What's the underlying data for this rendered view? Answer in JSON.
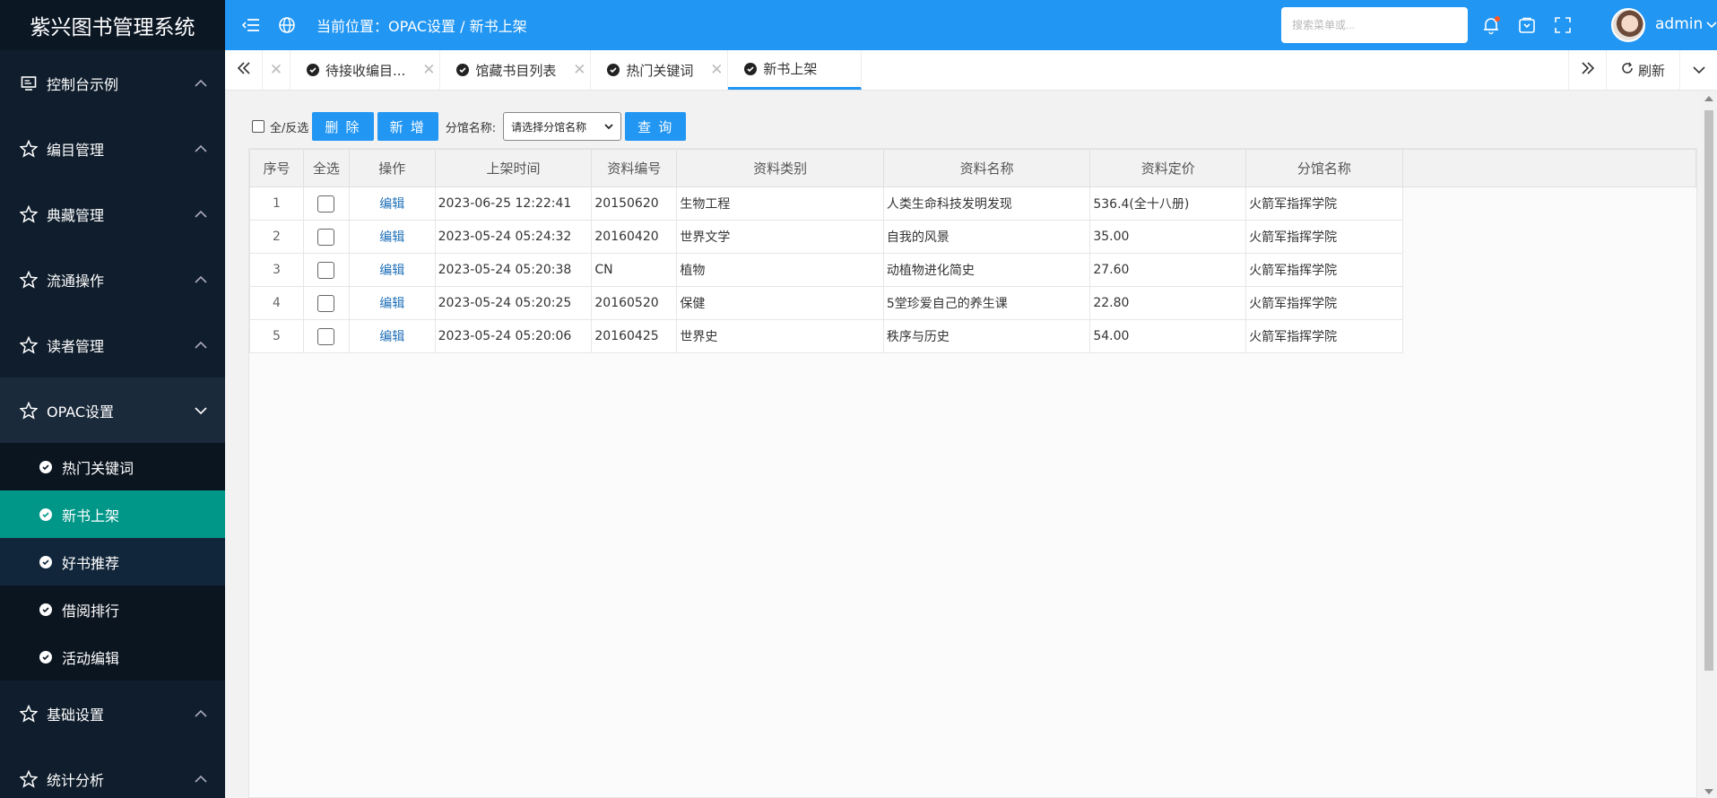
{
  "app": {
    "title": "紫兴图书管理系统"
  },
  "header": {
    "breadcrumb": "当前位置：OPAC设置 / 新书上架",
    "search_placeholder": "搜索菜单或...",
    "username": "admin"
  },
  "sidebar": {
    "groups": [
      {
        "label": "控制台示例",
        "icon": "console-icon"
      },
      {
        "label": "编目管理",
        "icon": "star-icon"
      },
      {
        "label": "典藏管理",
        "icon": "star-icon"
      },
      {
        "label": "流通操作",
        "icon": "star-icon"
      },
      {
        "label": "读者管理",
        "icon": "star-icon"
      },
      {
        "label": "OPAC设置",
        "icon": "star-icon"
      },
      {
        "label": "基础设置",
        "icon": "star-icon"
      },
      {
        "label": "统计分析",
        "icon": "star-icon"
      }
    ],
    "opac_items": [
      {
        "label": "热门关键词"
      },
      {
        "label": "新书上架"
      },
      {
        "label": "好书推荐"
      },
      {
        "label": "借阅排行"
      },
      {
        "label": "活动编辑"
      }
    ]
  },
  "tabs": [
    {
      "label": "待接收编目..."
    },
    {
      "label": "馆藏书目列表"
    },
    {
      "label": "热门关键词"
    },
    {
      "label": "新书上架"
    }
  ],
  "tabbar": {
    "refresh_label": "刷新"
  },
  "toolbar": {
    "select_all_label": "全/反选",
    "delete_label": "删 除",
    "add_label": "新 增",
    "branch_label": "分馆名称:",
    "branch_select": "请选择分馆名称",
    "query_label": "查 询"
  },
  "table": {
    "headers": [
      "序号",
      "全选",
      "操作",
      "上架时间",
      "资料编号",
      "资料类别",
      "资料名称",
      "资料定价",
      "分馆名称"
    ],
    "rows": [
      {
        "no": "1",
        "action": "编辑",
        "time": "2023-06-25 12:22:41",
        "code": "20150620",
        "category": "生物工程",
        "name": "人类生命科技发明发现",
        "price": "536.4(全十八册)",
        "branch": "火箭军指挥学院"
      },
      {
        "no": "2",
        "action": "编辑",
        "time": "2023-05-24 05:24:32",
        "code": "20160420",
        "category": "世界文学",
        "name": "自我的风景",
        "price": "35.00",
        "branch": "火箭军指挥学院"
      },
      {
        "no": "3",
        "action": "编辑",
        "time": "2023-05-24 05:20:38",
        "code": "CN",
        "category": "植物",
        "name": "动植物进化简史",
        "price": "27.60",
        "branch": "火箭军指挥学院"
      },
      {
        "no": "4",
        "action": "编辑",
        "time": "2023-05-24 05:20:25",
        "code": "20160520",
        "category": "保健",
        "name": "5堂珍爱自己的养生课",
        "price": "22.80",
        "branch": "火箭军指挥学院"
      },
      {
        "no": "5",
        "action": "编辑",
        "time": "2023-05-24 05:20:06",
        "code": "20160425",
        "category": "世界史",
        "name": "秩序与历史",
        "price": "54.00",
        "branch": "火箭军指挥学院"
      }
    ]
  },
  "colors": {
    "header": "#2196f3",
    "sidebar": "#0f1d2c",
    "active_item": "#009688",
    "link": "#1e6fb8"
  }
}
